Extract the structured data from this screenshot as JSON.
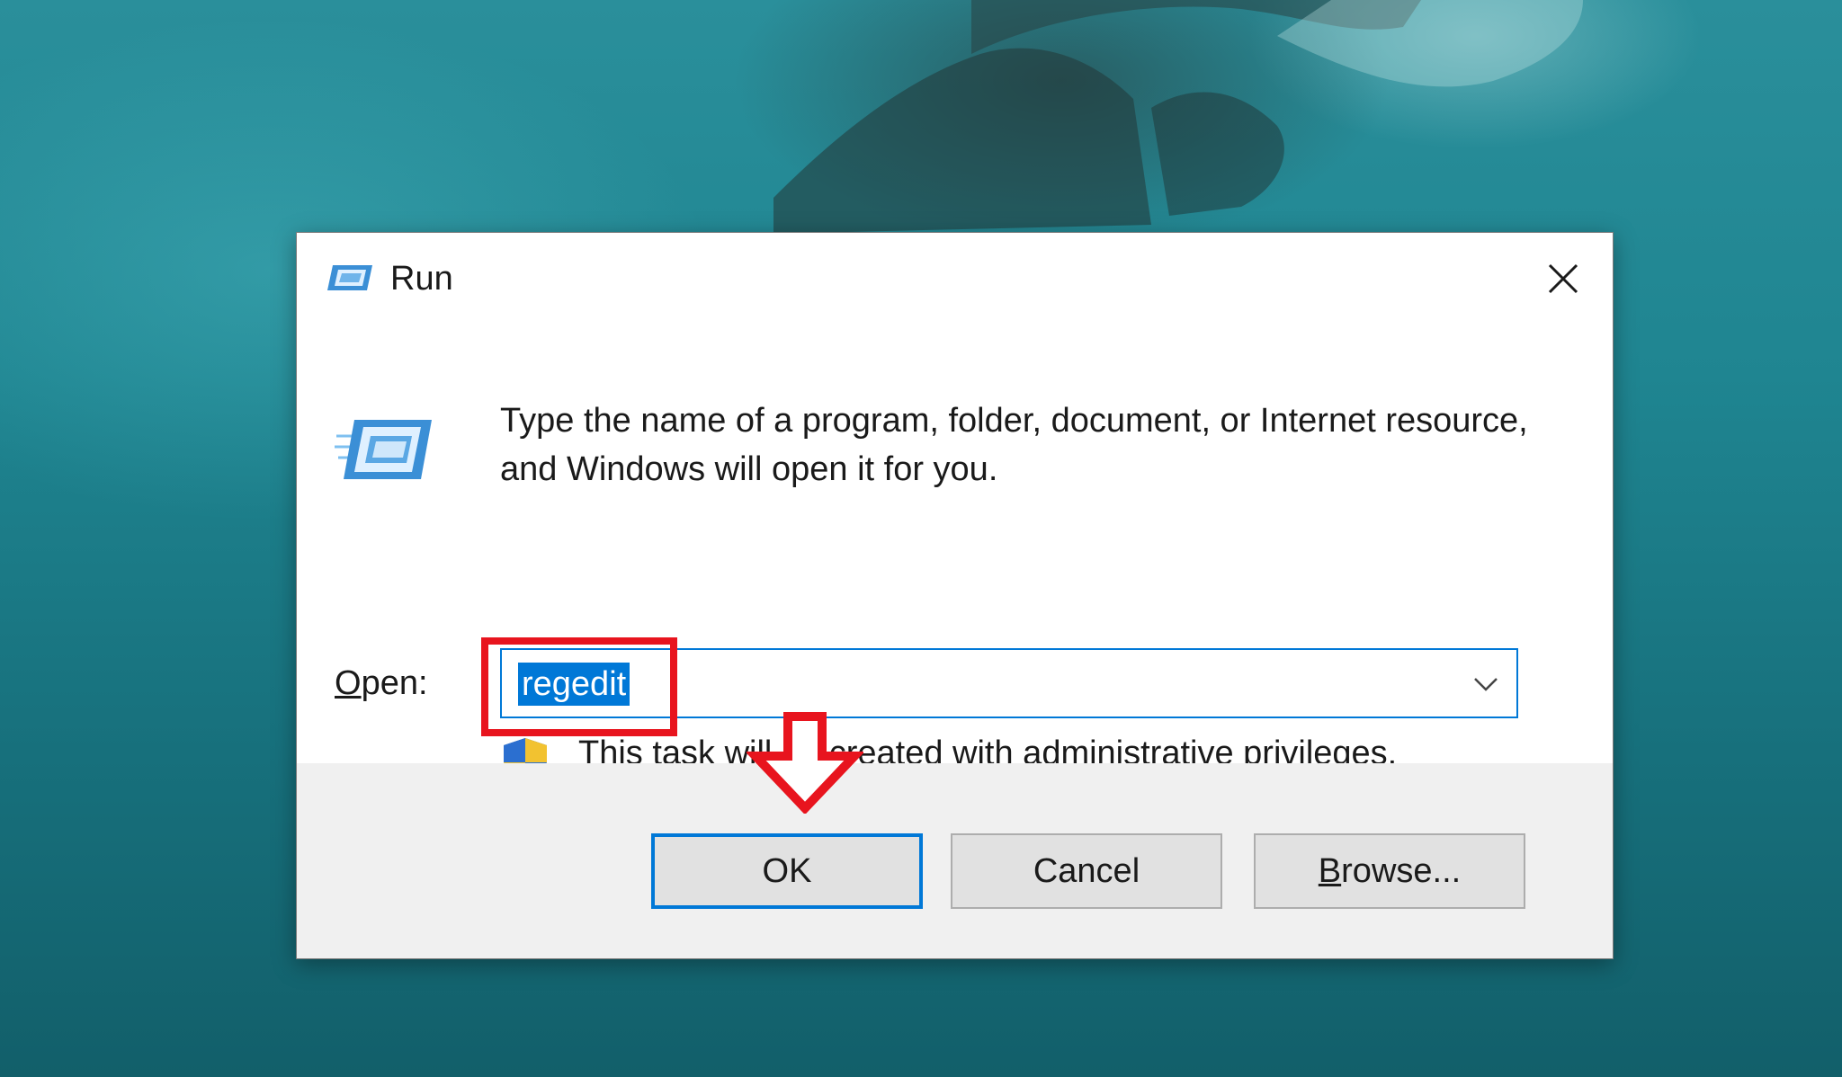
{
  "dialog": {
    "title": "Run",
    "description": "Type the name of a program, folder, document, or Internet resource, and Windows will open it for you.",
    "open_label_mnemonic": "O",
    "open_label_rest": "pen:",
    "open_value": "regedit",
    "admin_note": "This task will be created with administrative privileges.",
    "buttons": {
      "ok": "OK",
      "cancel": "Cancel",
      "browse_mnemonic": "B",
      "browse_rest": "rowse..."
    }
  },
  "icons": {
    "title": "run-icon",
    "close": "close-icon",
    "dropdown": "chevron-down-icon",
    "shield": "uac-shield-icon",
    "annotation": "red-down-arrow"
  },
  "colors": {
    "accent": "#0078d7",
    "annotation": "#e8141e",
    "footer": "#f0f0f0"
  }
}
